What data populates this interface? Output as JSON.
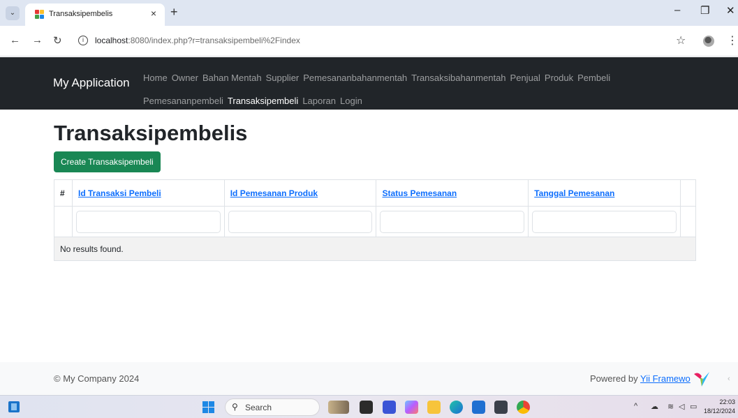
{
  "browser": {
    "tab_title": "Transaksipembelis",
    "tab_close": "×",
    "new_tab": "+",
    "url_host": "localhost",
    "url_path": ":8080/index.php?r=transaksipembeli%2Findex",
    "win_min": "–",
    "win_restore": "❐",
    "win_close": "✕"
  },
  "navbar": {
    "brand": "My Application",
    "links": [
      {
        "label": "Home",
        "active": false
      },
      {
        "label": "Owner",
        "active": false
      },
      {
        "label": "Bahan Mentah",
        "active": false
      },
      {
        "label": "Supplier",
        "active": false
      },
      {
        "label": "Pemesananbahanmentah",
        "active": false
      },
      {
        "label": "Transaksibahanmentah",
        "active": false
      },
      {
        "label": "Penjual",
        "active": false
      },
      {
        "label": "Produk",
        "active": false
      },
      {
        "label": "Pembeli",
        "active": false
      },
      {
        "label": "Pemesananpembeli",
        "active": false
      },
      {
        "label": "Transaksipembeli",
        "active": true
      },
      {
        "label": "Laporan",
        "active": false
      },
      {
        "label": "Login",
        "active": false
      }
    ]
  },
  "main": {
    "title": "Transaksipembelis",
    "create_button": "Create Transaksipembeli",
    "table": {
      "columns": [
        "#",
        "Id Transaksi Pembeli",
        "Id Pemesanan Produk",
        "Status Pemesanan",
        "Tanggal Pemesanan"
      ],
      "empty_message": "No results found."
    }
  },
  "footer": {
    "copyright": "© My Company 2024",
    "powered_prefix": "Powered by ",
    "powered_link": "Yii Framewo"
  },
  "taskbar": {
    "search_label": "Search",
    "time": "22:03",
    "date": "18/12/2024"
  },
  "colors": {
    "navbar_bg": "#212529",
    "create_button_bg": "#198754",
    "link": "#0d6efd"
  }
}
